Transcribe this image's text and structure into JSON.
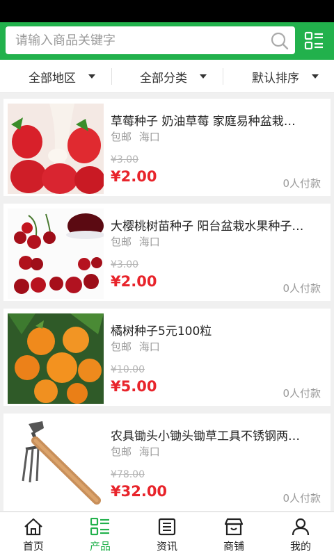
{
  "search": {
    "placeholder": "请输入商品关键字"
  },
  "filters": [
    {
      "label": "全部地区"
    },
    {
      "label": "全部分类"
    },
    {
      "label": "默认排序"
    }
  ],
  "products": [
    {
      "title": "草莓种子 奶油草莓 家庭易种盆栽…",
      "shipping": "包邮",
      "location": "海口",
      "old_price": "¥3.00",
      "price": "¥2.00",
      "sold": "0人付款"
    },
    {
      "title": "大樱桃树苗种子 阳台盆栽水果种子…",
      "shipping": "包邮",
      "location": "海口",
      "old_price": "¥3.00",
      "price": "¥2.00",
      "sold": "0人付款"
    },
    {
      "title": "橘树种子5元100粒",
      "shipping": "包邮",
      "location": "海口",
      "old_price": "¥10.00",
      "price": "¥5.00",
      "sold": "0人付款"
    },
    {
      "title": "农具锄头小锄头锄草工具不锈钢两…",
      "shipping": "包邮",
      "location": "海口",
      "old_price": "¥78.00",
      "price": "¥32.00",
      "sold": "0人付款"
    }
  ],
  "tabs": [
    {
      "label": "首页",
      "icon": "home-icon"
    },
    {
      "label": "产品",
      "icon": "product-grid-icon"
    },
    {
      "label": "资讯",
      "icon": "news-icon"
    },
    {
      "label": "商铺",
      "icon": "shop-icon"
    },
    {
      "label": "我的",
      "icon": "user-icon"
    }
  ],
  "colors": {
    "brand": "#22b14c",
    "price": "#e8242b",
    "muted": "#999999"
  }
}
